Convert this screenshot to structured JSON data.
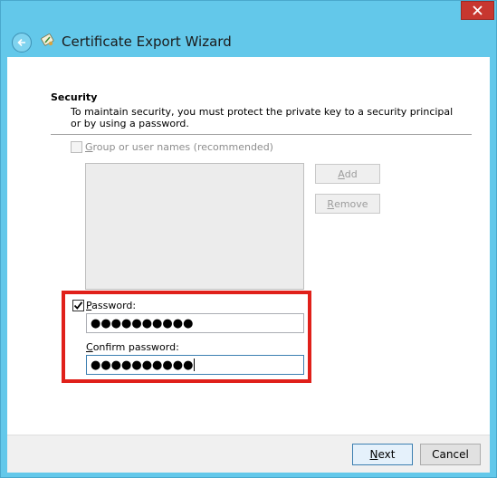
{
  "window": {
    "title": "Certificate Export Wizard",
    "close_label": "close"
  },
  "security": {
    "heading": "Security",
    "description": "To maintain security, you must protect the private key to a security principal or by using a password."
  },
  "group_option": {
    "label_ul": "G",
    "label_rest": "roup or user names (recommended)",
    "checked": false,
    "enabled": false
  },
  "buttons": {
    "add_ul": "A",
    "add_rest": "dd",
    "remove_ul": "R",
    "remove_rest": "emove"
  },
  "password_option": {
    "label_ul": "P",
    "label_rest": "assword:",
    "checked": true,
    "value": "●●●●●●●●●●"
  },
  "confirm": {
    "label_ul": "C",
    "label_rest": "onfirm password:",
    "value": "●●●●●●●●●●"
  },
  "footer": {
    "next_ul": "N",
    "next_rest": "ext",
    "cancel": "Cancel"
  },
  "colors": {
    "titlebar": "#63c8ea",
    "highlight": "#e0201a",
    "close": "#c7372f"
  }
}
